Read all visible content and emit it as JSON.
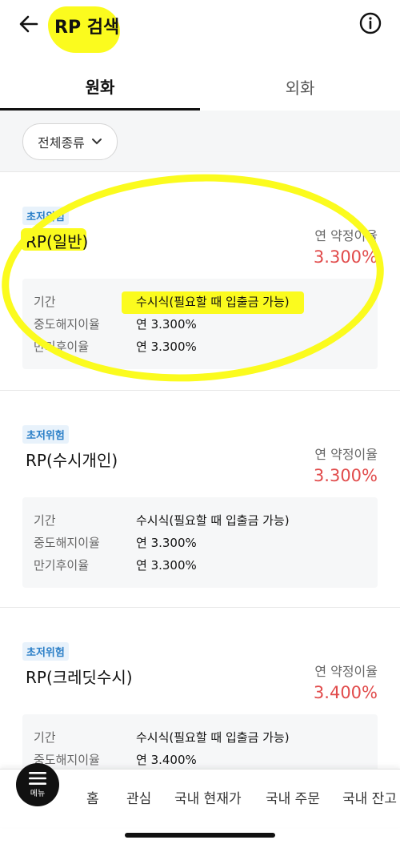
{
  "header": {
    "title": "RP 검색",
    "back_icon": "arrow-left-icon",
    "info_icon": "info-circle-icon"
  },
  "tabs": [
    {
      "label": "원화",
      "active": true
    },
    {
      "label": "외화",
      "active": false
    }
  ],
  "filter": {
    "label": "전체종류",
    "icon": "chevron-down-icon"
  },
  "cards": [
    {
      "risk": "초저위험",
      "name": "RP(일반)",
      "rate_label": "연 약정이율",
      "rate": "3.300%",
      "rows": [
        {
          "key": "기간",
          "value": "수시식(필요할 때 입출금 가능)"
        },
        {
          "key": "중도해지이율",
          "value": "연 3.300%"
        },
        {
          "key": "만기후이율",
          "value": "연 3.300%"
        }
      ]
    },
    {
      "risk": "초저위험",
      "name": "RP(수시개인)",
      "rate_label": "연 약정이율",
      "rate": "3.300%",
      "rows": [
        {
          "key": "기간",
          "value": "수시식(필요할 때 입출금 가능)"
        },
        {
          "key": "중도해지이율",
          "value": "연 3.300%"
        },
        {
          "key": "만기후이율",
          "value": "연 3.300%"
        }
      ]
    },
    {
      "risk": "초저위험",
      "name": "RP(크레딧수시)",
      "rate_label": "연 약정이율",
      "rate": "3.400%",
      "rows": [
        {
          "key": "기간",
          "value": "수시식(필요할 때 입출금 가능)"
        },
        {
          "key": "중도해지이율",
          "value": "연 3.400%"
        }
      ]
    }
  ],
  "bottom_nav": {
    "menu_label": "메뉴",
    "items": [
      "홈",
      "관심",
      "국내 현재가",
      "국내 주문",
      "국내 잔고"
    ]
  },
  "colors": {
    "rate_red": "#e14b4b",
    "risk_blue": "#2b7fc7",
    "highlight_yellow": "#fbfb1e"
  }
}
